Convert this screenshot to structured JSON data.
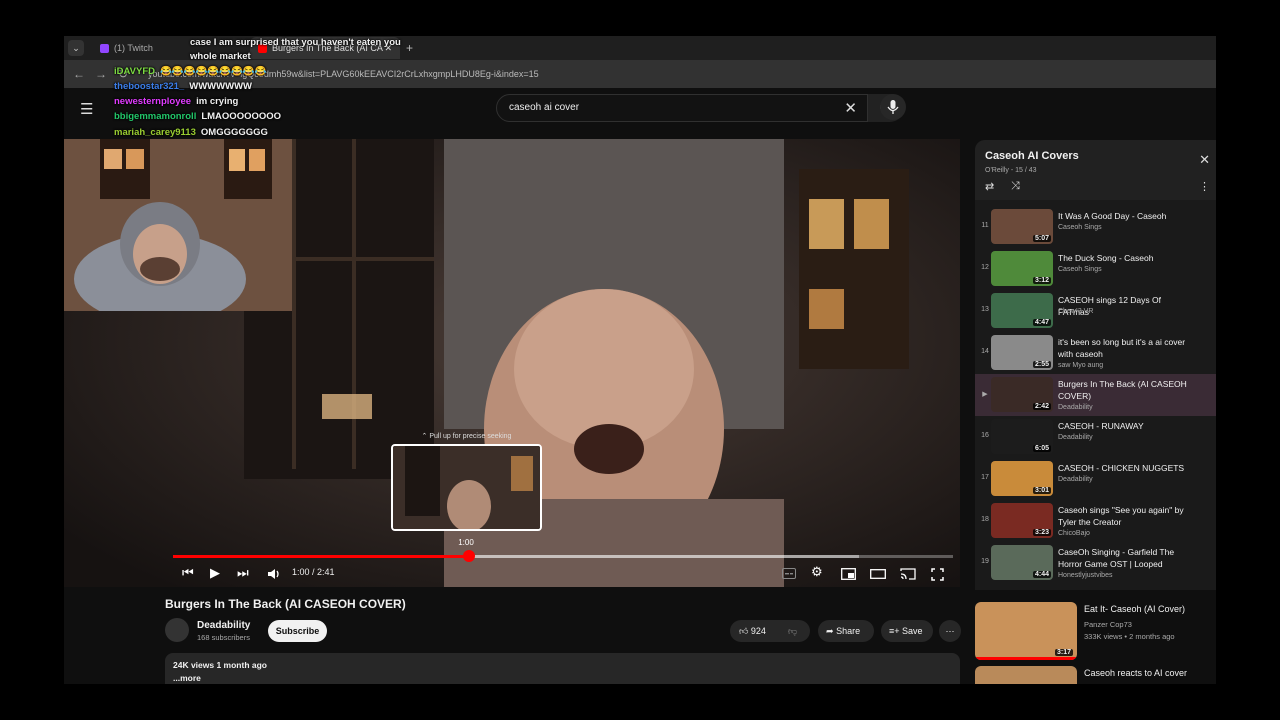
{
  "browser": {
    "tabs": [
      {
        "label": "(1) Twitch",
        "active": false
      },
      {
        "label": "Burgers In The Back (AI CA",
        "active": true
      }
    ],
    "url": "youtube.com/watch?v=lgQc3dmh59w&list=PLAVG60kEEAVCI2rCrLxhxgmpLHDU8Eg-i&index=15"
  },
  "youtube": {
    "search_query": "caseoh ai cover"
  },
  "chat": [
    {
      "user": "",
      "text": "case I am surprised that you haven't eaten you",
      "color": "#ffffff"
    },
    {
      "user": "",
      "text": "whole market",
      "color": "#ffffff"
    },
    {
      "user": "iDAVYFD",
      "text": "😂😂😂😂😂😂😂😂😂",
      "color": "#7ddc43"
    },
    {
      "user": "theboostar321_",
      "text": "WWWWWWW",
      "color": "#3b7de8"
    },
    {
      "user": "newesternployee",
      "text": "im crying",
      "color": "#e03cff"
    },
    {
      "user": "bbigemmamonroll",
      "text": "LMAOOOOOOOO",
      "color": "#22c76a"
    },
    {
      "user": "mariah_carey9113",
      "text": "OMGGGGGGG",
      "color": "#9acd32"
    }
  ],
  "player": {
    "current_time": "1:00",
    "duration": "2:41",
    "time_display": "1:00 / 2:41",
    "seek_hint": "Pull up for precise seeking",
    "preview_time": "1:00",
    "progress_fraction": 0.38
  },
  "video": {
    "title": "Burgers In The Back (AI CASEOH COVER)",
    "channel": "Deadability",
    "subscribers": "168 subscribers",
    "subscribe_label": "Subscribe",
    "likes": "924",
    "share_label": "Share",
    "save_label": "Save",
    "views_date": "24K views  1 month ago",
    "more_label": "...more"
  },
  "playlist": {
    "title": "Caseoh AI Covers",
    "subtitle": "O'Reilly - 15 / 43",
    "items": [
      {
        "index": "11",
        "title": "It Was A Good Day - Caseoh",
        "channel": "Caseoh Sings",
        "duration": "5:07",
        "color": "#6b4a3a"
      },
      {
        "index": "12",
        "title": "The Duck Song - Caseoh",
        "channel": "Caseoh Sings",
        "duration": "3:12",
        "color": "#4f8a3a"
      },
      {
        "index": "13",
        "title": "CASEOH sings 12 Days Of FATmas",
        "channel": "Chew!3 VR",
        "duration": "4:47",
        "color": "#3d6b4a"
      },
      {
        "index": "14",
        "title": "it's been so long but it's a ai cover with caseoh",
        "channel": "saw Myo aung",
        "duration": "2:55",
        "color": "#8a8a8a"
      },
      {
        "index": "▶",
        "title": "Burgers In The Back (AI CASEOH COVER)",
        "channel": "Deadability",
        "duration": "2:42",
        "color": "#3a2a26"
      },
      {
        "index": "16",
        "title": "CASEOH - RUNAWAY",
        "channel": "Deadability",
        "duration": "6:05",
        "color": "#1c1c1c"
      },
      {
        "index": "17",
        "title": "CASEOH - CHICKEN NUGGETS",
        "channel": "Deadability",
        "duration": "3:01",
        "color": "#c98b3a"
      },
      {
        "index": "18",
        "title": "Caseoh sings \"See you again\" by Tyler the Creator",
        "channel": "ChicoBajo",
        "duration": "3:23",
        "color": "#7a2a22"
      },
      {
        "index": "19",
        "title": "CaseOh Singing - Garfield The Horror Game OST | Looped",
        "channel": "Honestlyjustvibes",
        "duration": "4:44",
        "color": "#5a6a5a"
      }
    ]
  },
  "recommendations": [
    {
      "title": "Eat It- Caseoh (AI Cover)",
      "channel": "Panzer Cop73",
      "meta": "333K views  • 2 months ago",
      "duration": "3:17",
      "color": "#c9925a"
    },
    {
      "title": "Caseoh reacts to AI cover",
      "channel": "",
      "meta": "",
      "duration": "",
      "color": "#b98a5a"
    }
  ]
}
